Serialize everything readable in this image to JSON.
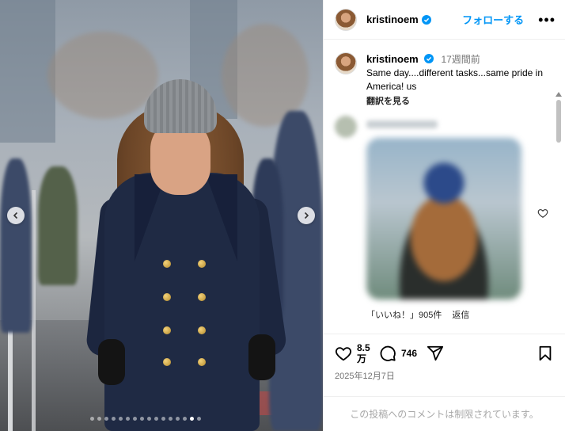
{
  "post": {
    "author": "kristinoem",
    "follow_label": "フォローする",
    "more_label": "•••"
  },
  "caption": {
    "username": "kristinoem",
    "time_ago": "17週間前",
    "text": "Same day....different tasks...same pride in America! us",
    "translate_label": "翻訳を見る"
  },
  "comment": {
    "likes_label": "「いいね！」905件",
    "reply_label": "返信"
  },
  "actions": {
    "likes_count": "8.5万",
    "comments_count": "746",
    "date": "2025年12月7日"
  },
  "footer": {
    "comments_disabled": "この投稿へのコメントは制限されています。"
  },
  "carousel": {
    "total_slides": 16,
    "active_slide": 15
  },
  "colors": {
    "accent": "#0095f6",
    "verified": "#0095f6",
    "muted_text": "#737373"
  },
  "icons": [
    "verified-badge-icon",
    "more-options-icon",
    "chevron-left-icon",
    "chevron-right-icon",
    "heart-icon",
    "comment-icon",
    "share-icon",
    "bookmark-icon"
  ]
}
